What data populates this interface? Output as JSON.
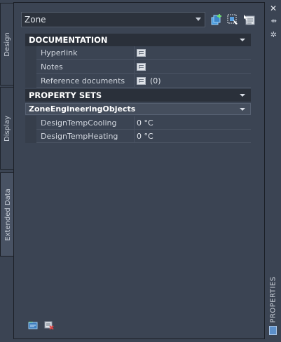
{
  "tabs": [
    {
      "label": "Design"
    },
    {
      "label": "Display"
    },
    {
      "label": "Extended Data"
    }
  ],
  "selector": {
    "value": "Zone"
  },
  "toolbar": {
    "icons": [
      "add-property-set-icon",
      "select-objects-icon",
      "quick-select-icon"
    ]
  },
  "documentation": {
    "title": "DOCUMENTATION",
    "rows": [
      {
        "label": "Hyperlink",
        "value": ""
      },
      {
        "label": "Notes",
        "value": ""
      },
      {
        "label": "Reference documents",
        "value": "(0)"
      }
    ]
  },
  "property_sets": {
    "title": "PROPERTY SETS",
    "group": "ZoneEngineeringObjects",
    "rows": [
      {
        "label": "DesignTempCooling",
        "value": "0 °C"
      },
      {
        "label": "DesignTempHeating",
        "value": "0 °C"
      }
    ]
  },
  "palette": {
    "title": "PROPERTIES",
    "close": "✕",
    "pin": "⇹",
    "settings": "✲"
  },
  "colors": {
    "background": "#3b4453",
    "section_header": "#2a303a",
    "accent_blue": "#5c8fc9"
  }
}
